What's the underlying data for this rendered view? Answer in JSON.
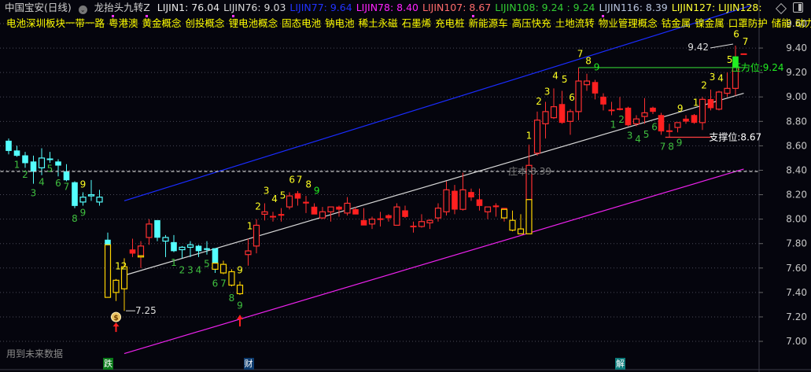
{
  "header": {
    "stock": "中国宝安(日线)",
    "indicator": "龙抬头九转Z",
    "values": [
      {
        "label": "LIJIN1: 76.04",
        "color": "#e8e8e8"
      },
      {
        "label": "LIJIN76: 9.03",
        "color": "#d8d8d8"
      },
      {
        "label": "LIJIN77: 9.64",
        "color": "#2233ff"
      },
      {
        "label": "LIJIN78: 8.40",
        "color": "#ff22ff"
      },
      {
        "label": "LIJIN107: 8.67",
        "color": "#ff6b6b"
      },
      {
        "label": "LIJIN108: 9.24 : 9.24",
        "color": "#33cc33"
      },
      {
        "label": "LIJIN116: 8.39",
        "color": "#b8c4dd"
      },
      {
        "label": "LIJIN127: LIJIN128:",
        "color": "#ffff33"
      }
    ]
  },
  "concepts": [
    "电池深圳板块一带一路",
    "粤港澳",
    "黄金概念",
    "创投概念",
    "锂电池概念",
    "固态电池",
    "钠电池",
    "稀土永磁",
    "石墨烯",
    "充电桩",
    "新能源车",
    "高压快充",
    "土地流转",
    "物业管理概念",
    "钴金属",
    "镍金属",
    "口罩防护",
    "储能",
    "动力"
  ],
  "footer_note": "用到未来数据",
  "event_tags": [
    {
      "text": "跌",
      "index": 12,
      "color": "#0a7a1a"
    },
    {
      "text": "财",
      "index": 29,
      "color": "#0d3b6e"
    },
    {
      "text": "解",
      "index": 74,
      "color": "#0b7a7a"
    }
  ],
  "chart_data": {
    "type": "candlestick",
    "title": "中国宝安(日线)",
    "ylim": [
      6.9,
      9.66
    ],
    "yticks": [
      "7.00",
      "7.20",
      "7.40",
      "7.60",
      "7.80",
      "8.00",
      "8.20",
      "8.40",
      "8.60",
      "8.80",
      "9.00",
      "9.20",
      "9.40",
      "9.60"
    ],
    "grid": true,
    "colors": {
      "c": "#54ffff",
      "ch": "#54ffff",
      "r": "#ff2020",
      "rh": "#ff3030",
      "y": "#ffd400",
      "g": "#22ee22"
    },
    "candles_format": [
      "open",
      "high",
      "low",
      "close",
      "style",
      "lower_style",
      "split_price"
    ],
    "candles": [
      [
        8.64,
        8.66,
        8.53,
        8.56,
        "c"
      ],
      [
        8.56,
        8.6,
        8.51,
        8.52,
        "c"
      ],
      [
        8.52,
        8.55,
        8.42,
        8.46,
        "c"
      ],
      [
        8.47,
        8.52,
        8.29,
        8.39,
        "c"
      ],
      [
        8.42,
        8.58,
        8.36,
        8.5,
        "ch"
      ],
      [
        8.49,
        8.55,
        8.46,
        8.49,
        "ch"
      ],
      [
        8.47,
        8.49,
        8.35,
        8.44,
        "c"
      ],
      [
        8.39,
        8.45,
        8.31,
        8.32,
        "c"
      ],
      [
        8.3,
        8.31,
        8.09,
        8.11,
        "c"
      ],
      [
        8.14,
        8.22,
        8.11,
        8.18,
        "ch"
      ],
      [
        8.19,
        8.32,
        8.15,
        8.2,
        "ch"
      ],
      [
        8.14,
        8.24,
        8.11,
        8.18,
        "ch"
      ],
      [
        7.83,
        7.89,
        7.36,
        7.36,
        "c",
        "y",
        7.79
      ],
      [
        7.5,
        7.51,
        7.33,
        7.4,
        "y"
      ],
      [
        7.43,
        7.68,
        7.25,
        7.61,
        "y"
      ],
      [
        7.75,
        7.84,
        7.69,
        7.72,
        "r"
      ],
      [
        7.69,
        7.82,
        7.6,
        7.78,
        "rh",
        "y",
        7.7
      ],
      [
        7.85,
        8.0,
        7.79,
        7.96,
        "rh"
      ],
      [
        7.99,
        7.99,
        7.82,
        7.85,
        "c"
      ],
      [
        7.82,
        7.87,
        7.69,
        7.85,
        "ch"
      ],
      [
        7.81,
        7.87,
        7.73,
        7.74,
        "c"
      ],
      [
        7.75,
        7.78,
        7.68,
        7.77,
        "ch"
      ],
      [
        7.77,
        7.82,
        7.69,
        7.79,
        "ch"
      ],
      [
        7.78,
        7.79,
        7.69,
        7.74,
        "c"
      ],
      [
        7.76,
        7.82,
        7.71,
        7.75,
        "c"
      ],
      [
        7.76,
        7.76,
        7.56,
        7.59,
        "c",
        "y",
        7.64
      ],
      [
        7.63,
        7.66,
        7.55,
        7.56,
        "y"
      ],
      [
        7.57,
        7.59,
        7.45,
        7.46,
        "y"
      ],
      [
        7.46,
        7.49,
        7.38,
        7.39,
        "y"
      ],
      [
        7.71,
        7.84,
        7.62,
        7.74,
        "rh"
      ],
      [
        7.78,
        8.0,
        7.72,
        7.95,
        "rh"
      ],
      [
        8.04,
        8.13,
        7.99,
        8.06,
        "rh"
      ],
      [
        8.02,
        8.06,
        7.98,
        8.02,
        "r"
      ],
      [
        8.04,
        8.09,
        7.98,
        8.03,
        "r"
      ],
      [
        8.1,
        8.22,
        8.08,
        8.19,
        "rh"
      ],
      [
        8.21,
        8.23,
        8.11,
        8.17,
        "r"
      ],
      [
        8.14,
        8.19,
        8.05,
        8.13,
        "r"
      ],
      [
        8.1,
        8.13,
        8.04,
        8.04,
        "r"
      ],
      [
        8.01,
        8.1,
        8.0,
        8.06,
        "rh"
      ],
      [
        8.06,
        8.1,
        7.98,
        8.1,
        "rh"
      ],
      [
        8.1,
        8.11,
        8.02,
        8.08,
        "r"
      ],
      [
        8.05,
        8.18,
        8.03,
        8.13,
        "rh"
      ],
      [
        8.08,
        8.1,
        8.04,
        8.04,
        "r"
      ],
      [
        7.99,
        8.09,
        7.95,
        7.95,
        "r"
      ],
      [
        7.96,
        8.02,
        7.92,
        8.0,
        "rh"
      ],
      [
        8.0,
        8.06,
        7.94,
        8.0,
        "r"
      ],
      [
        8.03,
        8.04,
        7.98,
        8.01,
        "r"
      ],
      [
        7.95,
        8.13,
        7.95,
        8.1,
        "rh"
      ],
      [
        8.07,
        8.11,
        8.01,
        8.02,
        "r"
      ],
      [
        7.94,
        7.98,
        7.89,
        7.94,
        "r"
      ],
      [
        7.94,
        8.04,
        7.93,
        7.98,
        "rh"
      ],
      [
        7.97,
        8.0,
        7.92,
        7.99,
        "rh"
      ],
      [
        8.01,
        8.13,
        7.98,
        8.09,
        "rh"
      ],
      [
        8.06,
        8.31,
        8.03,
        8.24,
        "rh"
      ],
      [
        8.23,
        8.28,
        8.04,
        8.08,
        "r"
      ],
      [
        8.08,
        8.38,
        8.07,
        8.24,
        "rh"
      ],
      [
        8.22,
        8.25,
        8.15,
        8.18,
        "r"
      ],
      [
        8.16,
        8.25,
        8.07,
        8.11,
        "r"
      ],
      [
        8.06,
        8.1,
        8.0,
        8.1,
        "rh"
      ],
      [
        8.11,
        8.13,
        8.02,
        8.1,
        "r"
      ],
      [
        8.09,
        8.09,
        7.98,
        8.01,
        "r",
        "y",
        8.08
      ],
      [
        7.99,
        8.07,
        7.9,
        7.91,
        "y"
      ],
      [
        7.92,
        8.04,
        7.88,
        7.88,
        "y"
      ],
      [
        7.88,
        8.61,
        7.88,
        8.44,
        "rh",
        "y",
        8.16
      ],
      [
        8.54,
        8.88,
        8.52,
        8.81,
        "rh"
      ],
      [
        8.78,
        8.96,
        8.66,
        8.88,
        "rh"
      ],
      [
        8.83,
        9.07,
        8.82,
        8.92,
        "rh"
      ],
      [
        8.94,
        9.05,
        8.78,
        8.79,
        "r"
      ],
      [
        8.8,
        8.9,
        8.69,
        8.88,
        "rh"
      ],
      [
        8.88,
        9.24,
        8.81,
        9.13,
        "rh"
      ],
      [
        9.1,
        9.19,
        9.05,
        9.13,
        "rh"
      ],
      [
        9.12,
        9.14,
        8.98,
        9.03,
        "r"
      ],
      [
        9.0,
        9.03,
        8.89,
        8.94,
        "r"
      ],
      [
        8.89,
        8.96,
        8.85,
        8.89,
        "r"
      ],
      [
        8.9,
        9.0,
        8.89,
        8.9,
        "r"
      ],
      [
        8.91,
        8.92,
        8.76,
        8.77,
        "r"
      ],
      [
        8.78,
        8.85,
        8.76,
        8.82,
        "rh"
      ],
      [
        8.84,
        8.99,
        8.78,
        8.87,
        "rh"
      ],
      [
        8.91,
        8.92,
        8.86,
        8.88,
        "r"
      ],
      [
        8.85,
        8.87,
        8.69,
        8.72,
        "r"
      ],
      [
        8.72,
        8.78,
        8.67,
        8.72,
        "r"
      ],
      [
        8.75,
        8.79,
        8.71,
        8.79,
        "rh"
      ],
      [
        8.82,
        8.85,
        8.78,
        8.8,
        "r"
      ],
      [
        8.85,
        8.86,
        8.78,
        8.79,
        "r"
      ],
      [
        8.79,
        9.0,
        8.73,
        8.98,
        "rh"
      ],
      [
        8.98,
        9.06,
        8.89,
        8.91,
        "r"
      ],
      [
        8.9,
        9.05,
        8.89,
        9.04,
        "rh"
      ],
      [
        9.03,
        9.2,
        9.0,
        9.07,
        "rh"
      ],
      [
        9.07,
        9.42,
        9.01,
        9.33,
        "g",
        "rh",
        9.24
      ],
      [
        9.35,
        9.35,
        9.35,
        9.35,
        "r"
      ]
    ],
    "trend_lines": [
      {
        "name": "channel-upper",
        "color": "#1a2cff",
        "from": [
          14,
          8.15
        ],
        "to": [
          90,
          9.75
        ]
      },
      {
        "name": "channel-mid",
        "color": "#d8d8d8",
        "from": [
          14,
          7.54
        ],
        "to": [
          89,
          9.03
        ]
      },
      {
        "name": "channel-lower",
        "color": "#ee22ee",
        "from": [
          14,
          6.9
        ],
        "to": [
          89,
          8.41
        ]
      }
    ],
    "levels": [
      {
        "name": "cost-line",
        "price": 8.39,
        "label": "庄本:8.39",
        "color": "#cfcfcf",
        "label_color": "#7a7a7a",
        "from": -1,
        "to": 91,
        "label_at": 60.5,
        "dashed": true
      },
      {
        "name": "resistance-line",
        "price": 9.24,
        "label": "压力位:9.24",
        "color": "#33cc33",
        "label_color": "#22ee22",
        "from": 69,
        "to": 89.5,
        "label_at": 87.5,
        "dashed": false
      },
      {
        "name": "support-line",
        "price": 8.67,
        "label": "支撑位:8.67",
        "color": "#ff4040",
        "label_color": "#ffffff",
        "from": 79.5,
        "to": 85,
        "label_at": 84.8,
        "dashed": false
      }
    ],
    "extremes": [
      {
        "name": "high-marker",
        "index": 88,
        "price": 9.42,
        "label": "9.42",
        "side": "left"
      },
      {
        "name": "low-marker",
        "index": 14,
        "price": 7.25,
        "label": "7.25",
        "side": "right"
      }
    ],
    "annotations_format": [
      "index",
      "text",
      "color",
      "price"
    ],
    "annotation_colors": {
      "g": "#3fbf3f",
      "y": "#ffff22",
      "gb": "#22ee22"
    },
    "annotations": [
      [
        1,
        "1",
        "g",
        8.45
      ],
      [
        2,
        "2",
        "g",
        8.37
      ],
      [
        3,
        "3",
        "g",
        8.22
      ],
      [
        4,
        "4",
        "g",
        8.31
      ],
      [
        5,
        "5",
        "g",
        8.42
      ],
      [
        6,
        "6",
        "g",
        8.3
      ],
      [
        7,
        "7",
        "g",
        8.27
      ],
      [
        8,
        "8",
        "g",
        8.01
      ],
      [
        9,
        "9",
        "g",
        8.06
      ],
      [
        9,
        "9",
        "y",
        8.29
      ],
      [
        13.6,
        "12",
        "y",
        7.62
      ],
      [
        20,
        "1",
        "g",
        7.65
      ],
      [
        21,
        "2",
        "g",
        7.59
      ],
      [
        22,
        "3",
        "g",
        7.59
      ],
      [
        23,
        "4",
        "g",
        7.59
      ],
      [
        24,
        "5",
        "g",
        7.64
      ],
      [
        25,
        "6",
        "g",
        7.48
      ],
      [
        26,
        "7",
        "g",
        7.48
      ],
      [
        27,
        "8",
        "g",
        7.36
      ],
      [
        28,
        "9",
        "g",
        7.3
      ],
      [
        28,
        "9",
        "y",
        7.59
      ],
      [
        29.2,
        "1",
        "y",
        7.95
      ],
      [
        30.2,
        "2",
        "y",
        8.11
      ],
      [
        31.2,
        "3",
        "y",
        8.24
      ],
      [
        32.2,
        "4",
        "y",
        8.17
      ],
      [
        33.2,
        "5",
        "y",
        8.2
      ],
      [
        34.3,
        "6",
        "y",
        8.33
      ],
      [
        35.2,
        "7",
        "y",
        8.33
      ],
      [
        36.3,
        "8",
        "y",
        8.29
      ],
      [
        37.3,
        "9",
        "gb",
        8.24
      ],
      [
        63,
        "1",
        "y",
        8.69
      ],
      [
        64.2,
        "2",
        "y",
        8.97
      ],
      [
        65.2,
        "3",
        "y",
        9.05
      ],
      [
        66.2,
        "4",
        "y",
        9.18
      ],
      [
        67.3,
        "5",
        "y",
        9.15
      ],
      [
        68.2,
        "6",
        "y",
        9.0
      ],
      [
        69.2,
        "7",
        "y",
        9.36
      ],
      [
        70.2,
        "8",
        "y",
        9.3
      ],
      [
        71.2,
        "9",
        "gb",
        9.25
      ],
      [
        73.2,
        "1",
        "g",
        8.78
      ],
      [
        74.2,
        "2",
        "g",
        8.82
      ],
      [
        75.2,
        "3",
        "g",
        8.69
      ],
      [
        76.2,
        "4",
        "g",
        8.66
      ],
      [
        77.2,
        "5",
        "g",
        8.7
      ],
      [
        78.2,
        "6",
        "g",
        8.76
      ],
      [
        79.2,
        "7",
        "g",
        8.6
      ],
      [
        80.2,
        "8",
        "g",
        8.6
      ],
      [
        81.2,
        "9",
        "g",
        8.63
      ],
      [
        81.3,
        "9",
        "y",
        8.91
      ],
      [
        83.2,
        "1",
        "y",
        8.96
      ],
      [
        84.2,
        "2",
        "y",
        9.1
      ],
      [
        85.2,
        "3",
        "y",
        9.17
      ],
      [
        86.2,
        "4",
        "y",
        9.16
      ],
      [
        87.3,
        "5",
        "y",
        9.31
      ],
      [
        88.1,
        "6",
        "y",
        9.52
      ],
      [
        89.2,
        "7",
        "y",
        9.46
      ]
    ],
    "signal_icons": [
      {
        "name": "money-bag-icon",
        "index": 13,
        "price": 7.18
      },
      {
        "name": "red-up-arrow-icon",
        "index": 28,
        "price": 7.18
      }
    ]
  }
}
